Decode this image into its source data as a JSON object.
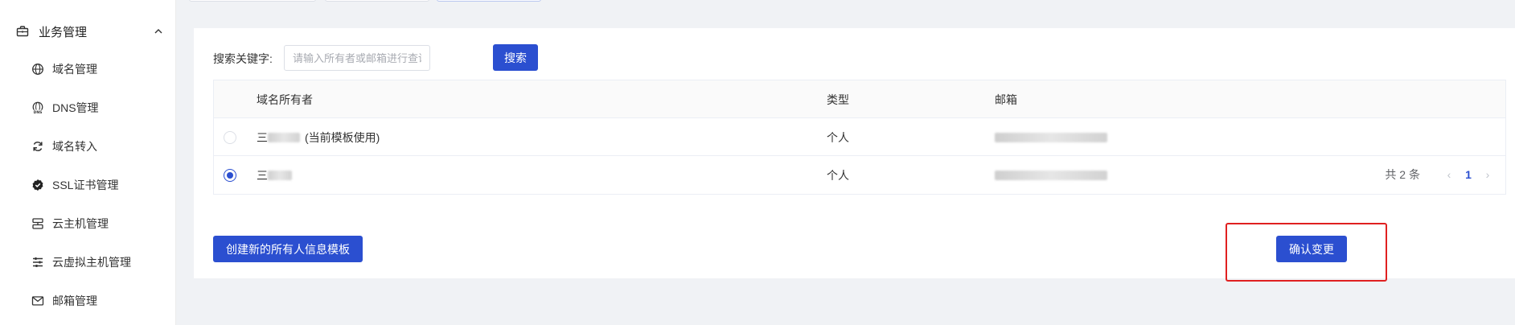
{
  "sidebar": {
    "group": {
      "label": "业务管理",
      "icon": "briefcase-icon"
    },
    "items": [
      {
        "label": "域名管理",
        "icon": "globe-icon"
      },
      {
        "label": "DNS管理",
        "icon": "dns-globe-icon"
      },
      {
        "label": "域名转入",
        "icon": "refresh-icon"
      },
      {
        "label": "SSL证书管理",
        "icon": "shield-check-icon"
      },
      {
        "label": "云主机管理",
        "icon": "server-icon"
      },
      {
        "label": "云虚拟主机管理",
        "icon": "sliders-icon"
      },
      {
        "label": "邮箱管理",
        "icon": "mail-icon"
      }
    ]
  },
  "search": {
    "label": "搜索关键字:",
    "placeholder": "请输入所有者或邮箱进行查询",
    "value": "",
    "button": "搜索"
  },
  "table": {
    "headers": {
      "owner": "域名所有者",
      "type": "类型",
      "email": "邮箱"
    },
    "rows": [
      {
        "owner_prefix": "三",
        "owner_note": "(当前模板使用)",
        "type": "个人",
        "email_prefix": "",
        "selected": false
      },
      {
        "owner_prefix": "三",
        "owner_note": "",
        "type": "个人",
        "email_prefix": "",
        "selected": true
      }
    ]
  },
  "pagination": {
    "total": "共 2 条",
    "current": "1"
  },
  "actions": {
    "create": "创建新的所有人信息模板",
    "confirm": "确认变更"
  },
  "colors": {
    "primary": "#2b4fd0",
    "highlight": "#e02020"
  }
}
